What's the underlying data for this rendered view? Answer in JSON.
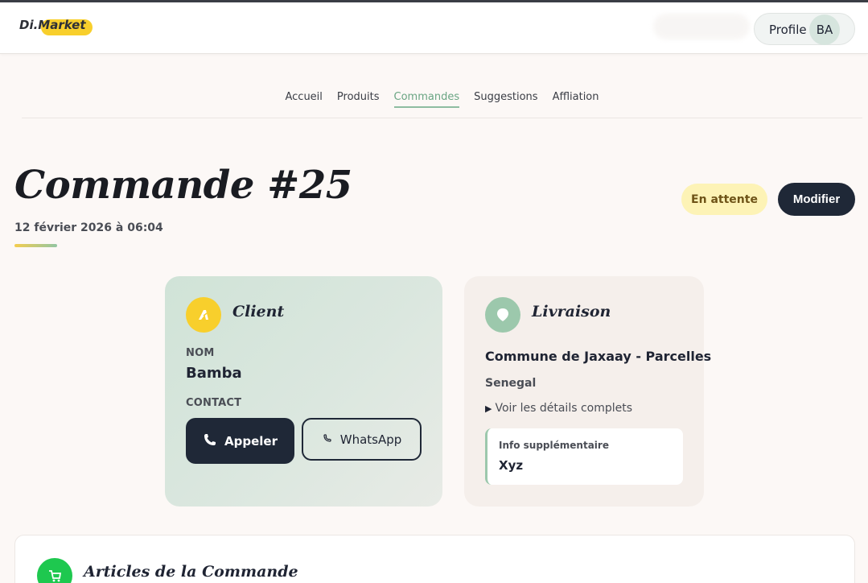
{
  "header": {
    "logo_text": "Di.Market",
    "profile_label": "Profile",
    "avatar_initials": "BA"
  },
  "nav": {
    "items": [
      {
        "label": "Accueil"
      },
      {
        "label": "Produits"
      },
      {
        "label": "Commandes",
        "active": true
      },
      {
        "label": "Suggestions"
      },
      {
        "label": "Affliation"
      }
    ]
  },
  "order": {
    "title": "Commande #25",
    "date": "12 février 2026 à 06:04",
    "status": "En attente",
    "edit_label": "Modifier"
  },
  "client": {
    "title": "Client",
    "name_label": "NOM",
    "name": "Bamba",
    "contact_label": "CONTACT",
    "call_label": "Appeler",
    "whatsapp_label": "WhatsApp"
  },
  "delivery": {
    "title": "Livraison",
    "address": "Commune de Jaxaay - Parcelles",
    "country": "Senegal",
    "details_toggle": "Voir les détails complets",
    "extra_label": "Info supplémentaire",
    "extra_value": "Xyz"
  },
  "items": {
    "title": "Articles de la Commande"
  },
  "colors": {
    "accent_green": "#8ebda1",
    "brand_yellow": "#f8cf2c",
    "dark_navy": "#1f2837",
    "status_bg": "#fdf3b6",
    "whatsapp_green": "#1ec84f"
  }
}
